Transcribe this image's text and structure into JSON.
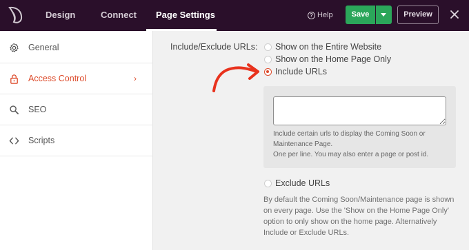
{
  "header": {
    "tabs": [
      {
        "label": "Design"
      },
      {
        "label": "Connect"
      },
      {
        "label": "Page Settings"
      }
    ],
    "help_label": "Help",
    "help_glyph": "?",
    "save_label": "Save",
    "preview_label": "Preview",
    "colors": {
      "bar": "#2a0f2a",
      "save": "#2ba65a"
    }
  },
  "sidebar": {
    "items": [
      {
        "label": "General",
        "icon": "gear-icon"
      },
      {
        "label": "Access Control",
        "icon": "lock-icon",
        "active": true
      },
      {
        "label": "SEO",
        "icon": "search-icon"
      },
      {
        "label": "Scripts",
        "icon": "code-icon"
      }
    ],
    "active_color": "#dd4a2a"
  },
  "main": {
    "field_label": "Include/Exclude URLs:",
    "options": [
      {
        "label": "Show on the Entire Website",
        "checked": false
      },
      {
        "label": "Show on the Home Page Only",
        "checked": false
      },
      {
        "label": "Include URLs",
        "checked": true
      },
      {
        "label": "Exclude URLs",
        "checked": false
      }
    ],
    "include_box": {
      "textarea_value": "",
      "help_line1": "Include certain urls to display the Coming Soon or Maintenance Page.",
      "help_line2": "One per line. You may also enter a page or post id."
    },
    "exclude_description": "By default the Coming Soon/Maintenance page is shown on every page. Use the 'Show on the Home Page Only' option to only show on the home page. Alternatively Include or Exclude URLs."
  }
}
